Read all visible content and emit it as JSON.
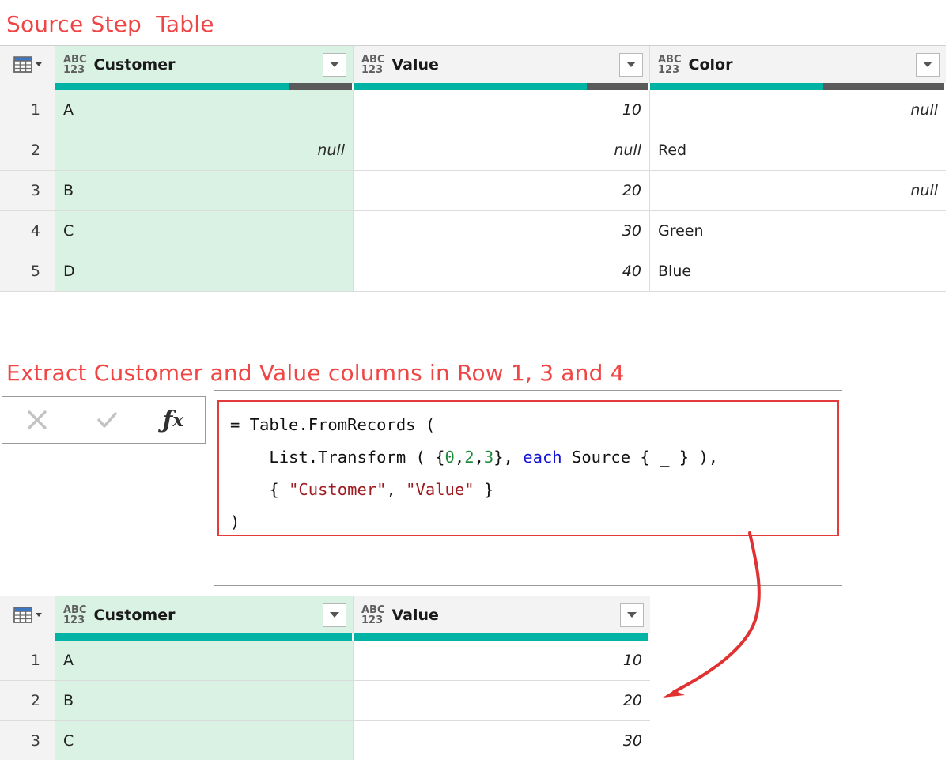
{
  "annotations": {
    "source_title": "Source Step  Table",
    "step_title": "Extract Customer and Value columns in Row 1, 3 and 4",
    "accent_color": "#f04545"
  },
  "colors": {
    "quality_good": "#00b3a4",
    "quality_bad": "#5a5a5a",
    "selected_column": "#d9f2e3",
    "header_bg": "#f3f3f3",
    "formula_box_border": "#e33b3b"
  },
  "source_table": {
    "grid_icon": "table-grid-icon",
    "columns": [
      {
        "type_icon": "abc123-icon",
        "type_top": "ABC",
        "type_bottom": "123",
        "name": "Customer",
        "selected": true,
        "quality_good_pct": 79,
        "quality_bad_pct": 21,
        "filter_icon": "filter-dropdown-icon"
      },
      {
        "type_icon": "abc123-icon",
        "type_top": "ABC",
        "type_bottom": "123",
        "name": "Value",
        "selected": false,
        "quality_good_pct": 79,
        "quality_bad_pct": 21,
        "filter_icon": "filter-dropdown-icon"
      },
      {
        "type_icon": "abc123-icon",
        "type_top": "ABC",
        "type_bottom": "123",
        "name": "Color",
        "selected": false,
        "quality_good_pct": 59,
        "quality_bad_pct": 41,
        "filter_icon": "filter-dropdown-icon"
      }
    ],
    "rows": [
      {
        "num": "1",
        "cells": [
          "A",
          "10",
          "null"
        ]
      },
      {
        "num": "2",
        "cells": [
          "null",
          "null",
          "Red"
        ]
      },
      {
        "num": "3",
        "cells": [
          "B",
          "20",
          "null"
        ]
      },
      {
        "num": "4",
        "cells": [
          "C",
          "30",
          "Green"
        ]
      },
      {
        "num": "5",
        "cells": [
          "D",
          "40",
          "Blue"
        ]
      }
    ]
  },
  "formula_bar": {
    "cancel_icon": "cancel-x-icon",
    "accept_icon": "accept-check-icon",
    "function_icon": "fx-icon",
    "formula_lines": [
      "= Table.FromRecords (",
      "    List.Transform ( {0,2,3}, each Source { _ } ),",
      "    { \"Customer\", \"Value\" }",
      ")"
    ],
    "line1": {
      "text": "= Table.FromRecords ("
    },
    "line2": {
      "pre": "    List.Transform ( {",
      "n0": "0",
      "c1": ",",
      "n2": "2",
      "c2": ",",
      "n3": "3",
      "mid": "}, ",
      "kw": "each",
      "post": " Source { _ } ),"
    },
    "line3": {
      "pre": "    { ",
      "s1": "\"Customer\"",
      "mid": ", ",
      "s2": "\"Value\"",
      "post": " }"
    },
    "line4": {
      "text": ")"
    }
  },
  "result_table": {
    "grid_icon": "table-grid-icon",
    "columns": [
      {
        "type_top": "ABC",
        "type_bottom": "123",
        "name": "Customer",
        "selected": true,
        "quality_good_pct": 100,
        "quality_bad_pct": 0,
        "filter_icon": "filter-dropdown-icon"
      },
      {
        "type_top": "ABC",
        "type_bottom": "123",
        "name": "Value",
        "selected": false,
        "quality_good_pct": 100,
        "quality_bad_pct": 0,
        "filter_icon": "filter-dropdown-icon"
      }
    ],
    "rows": [
      {
        "num": "1",
        "cells": [
          "A",
          "10"
        ]
      },
      {
        "num": "2",
        "cells": [
          "B",
          "20"
        ]
      },
      {
        "num": "3",
        "cells": [
          "C",
          "30"
        ]
      }
    ]
  }
}
